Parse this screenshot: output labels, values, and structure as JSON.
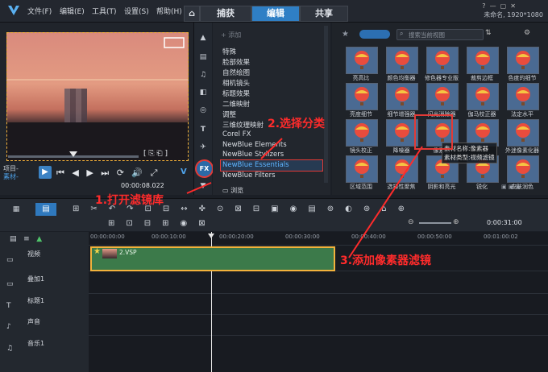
{
  "menu": [
    "文件(F)",
    "编辑(E)",
    "工具(T)",
    "设置(S)",
    "帮助(H)"
  ],
  "tabs": {
    "capture": "捕获",
    "edit": "编辑",
    "share": "共享"
  },
  "project_info": "未命名, 1920*1080",
  "preview": {
    "mode_project": "项目-",
    "mode_clip": "素材-",
    "timecode": "00:00:08.022",
    "ratio_label": "V"
  },
  "library": {
    "add_label": "添加",
    "browse_label": "浏览",
    "search_placeholder": "搜索当前视图",
    "categories": [
      "特殊",
      "脸部效果",
      "自然绘图",
      "相机镜头",
      "标题效果",
      "二维映射",
      "调整",
      "三维纹理映射",
      "Corel FX",
      "NewBlue Elements",
      "NewBlue Stylizers",
      "NewBlue Essentials",
      "NewBlue Filters"
    ],
    "selected_category": "NewBlue Essentials",
    "thumbs": [
      "亮高比",
      "颜色均衡器",
      "修色器专业版",
      "裁剪边框",
      "色度的细节",
      "亮度细节",
      "细节增强器",
      "闪光消除器",
      "伽马校正器",
      "法定水平",
      "镜头校正",
      "降噪器",
      "像素器",
      "",
      "外迷像素化器",
      "区域范围",
      "选择性聚焦",
      "阴影和亮光",
      "锐化",
      "皮肤润色"
    ],
    "tooltip": [
      "素材名称:像素器",
      "素材类型:视频滤镜"
    ],
    "fx_label": "FX"
  },
  "annotations": {
    "step1": "1.打开滤镜库",
    "step2": "2.选择分类",
    "step3": "3.添加像素器滤镜"
  },
  "timeline": {
    "ruler": [
      "00:00:00:00",
      "00:00:10:00",
      "00:00:20:00",
      "00:00:30:00",
      "00:00:40:00",
      "00:00:50:00",
      "00:01:00:02"
    ],
    "timecode": "0:00:31:00",
    "tracks": [
      "视频",
      "叠加1",
      "标题1",
      "声音",
      "音乐1"
    ],
    "clip_name": "2.VSP"
  }
}
